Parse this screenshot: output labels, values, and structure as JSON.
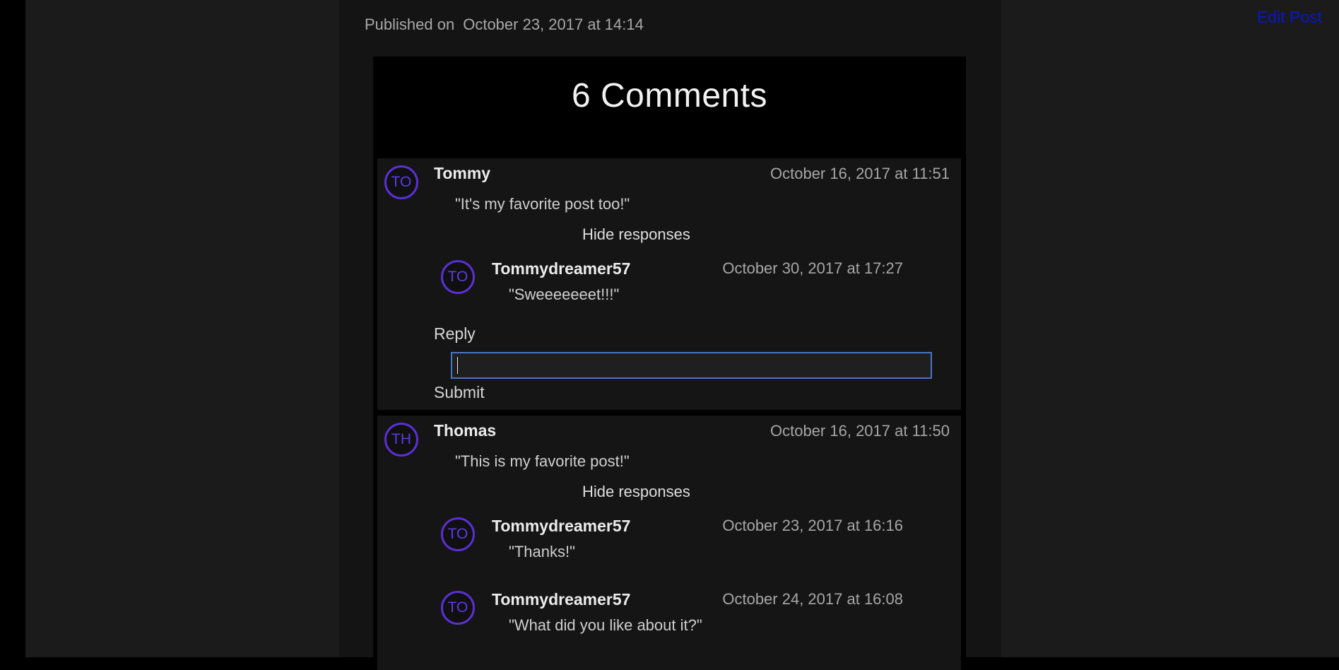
{
  "post": {
    "published_label": "Published on",
    "published_date": "October 23, 2017 at 14:14",
    "edit_label": "Edit Post"
  },
  "comments_section": {
    "title": "6 Comments",
    "comments": [
      {
        "avatar": "TO",
        "author": "Tommy",
        "date": "October 16, 2017 at 11:51",
        "text": "\"It's my favorite post too!\"",
        "toggle_label": "Hide responses",
        "responses": [
          {
            "avatar": "TO",
            "author": "Tommydreamer57",
            "date": "October 30, 2017 at 17:27",
            "text": "\"Sweeeeeeet!!!\""
          }
        ],
        "reply_label": "Reply",
        "reply_value": "",
        "submit_label": "Submit"
      },
      {
        "avatar": "TH",
        "author": "Thomas",
        "date": "October 16, 2017 at 11:50",
        "text": "\"This is my favorite post!\"",
        "toggle_label": "Hide responses",
        "responses": [
          {
            "avatar": "TO",
            "author": "Tommydreamer57",
            "date": "October 23, 2017 at 16:16",
            "text": "\"Thanks!\""
          },
          {
            "avatar": "TO",
            "author": "Tommydreamer57",
            "date": "October 24, 2017 at 16:08",
            "text": "\"What did you like about it?\""
          }
        ]
      }
    ]
  },
  "colors": {
    "page_background": "#1b1b1b",
    "column_background": "#141414",
    "card_background": "#151515",
    "avatar_accent": "#5b2fd6",
    "link_color": "#0b16c9",
    "input_border": "#4a76c8"
  }
}
